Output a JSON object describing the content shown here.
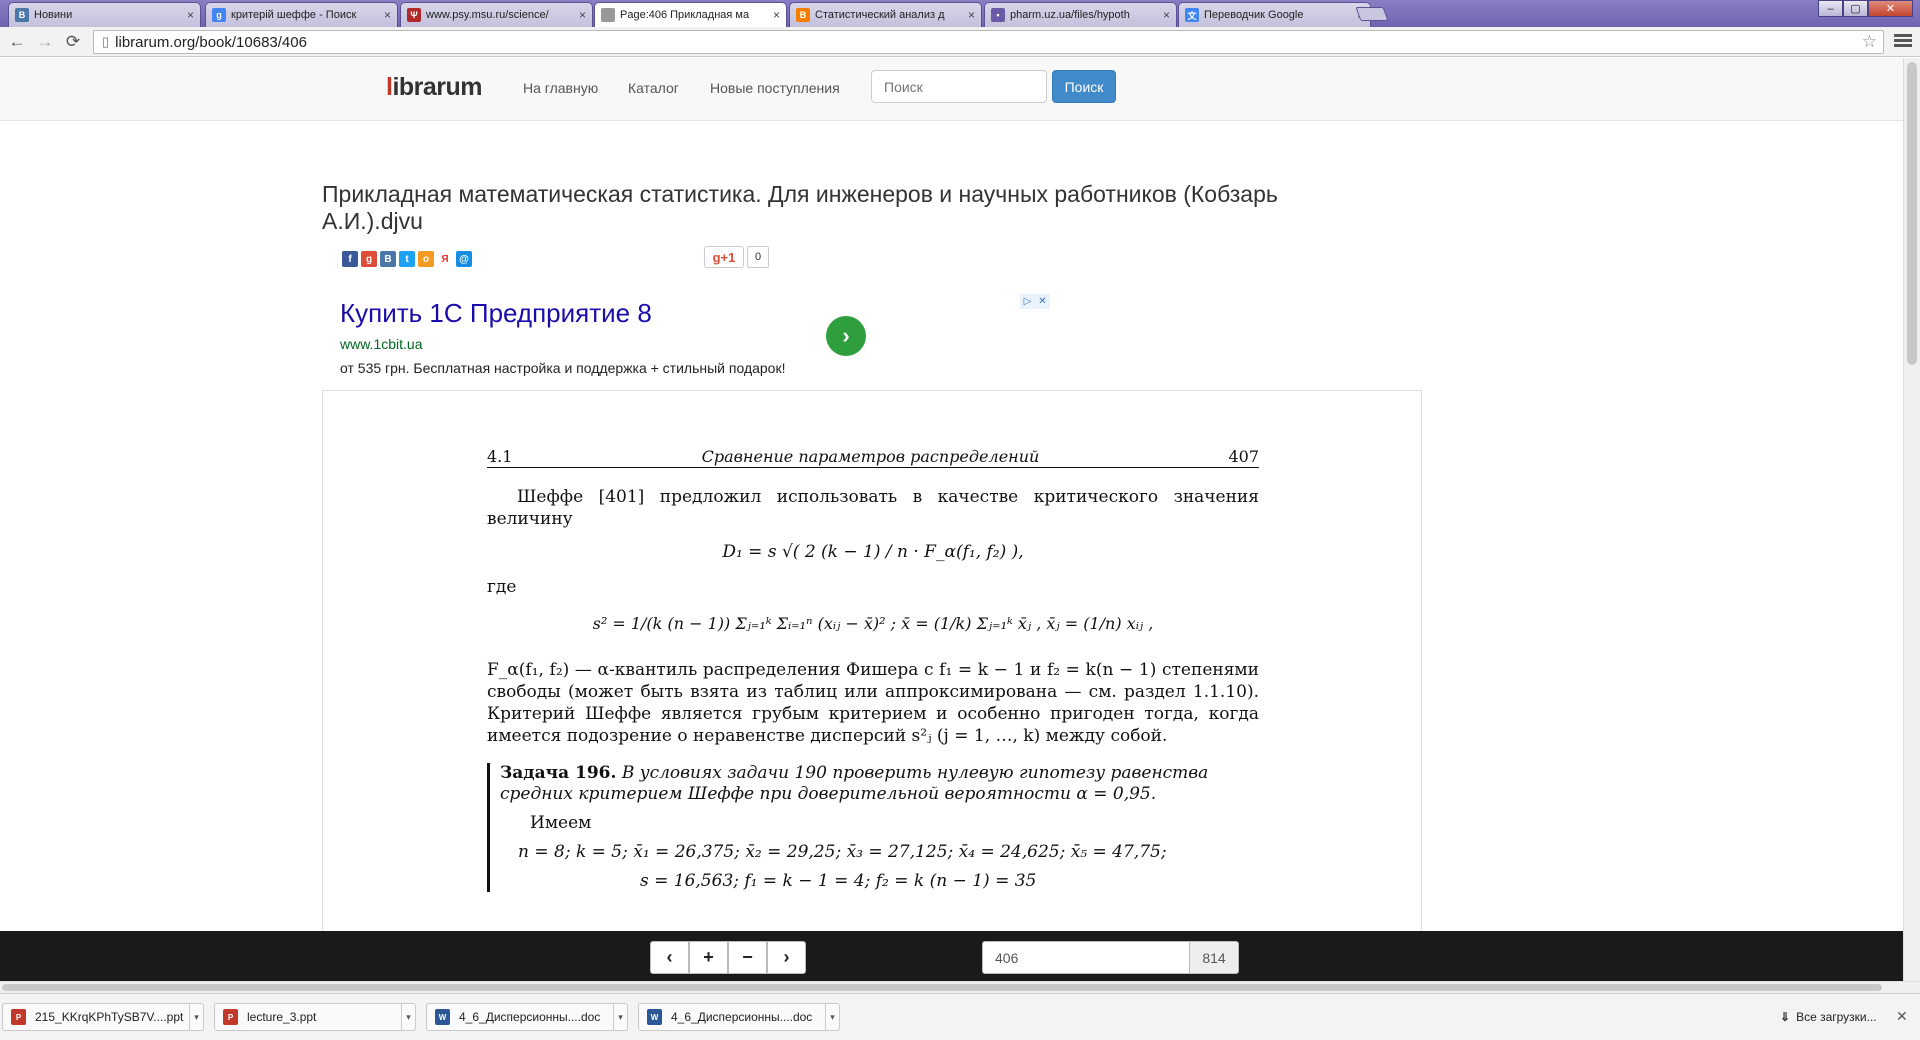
{
  "tabs": [
    {
      "label": "Новини",
      "favicon": "vk-icon",
      "color": "#4a76a8",
      "glyph": "В"
    },
    {
      "label": "критерій шеффе - Поиск",
      "favicon": "google-icon",
      "color": "#4285f4",
      "glyph": "g"
    },
    {
      "label": "www.psy.msu.ru/science/",
      "favicon": "psi-icon",
      "color": "#b02a2a",
      "glyph": "Ψ"
    },
    {
      "label": "Page:406 Прикладная ма",
      "favicon": "page-icon",
      "color": "#999999",
      "glyph": "",
      "active": true
    },
    {
      "label": "Статистический анализ д",
      "favicon": "blogger-icon",
      "color": "#f57d00",
      "glyph": "B"
    },
    {
      "label": "pharm.uz.ua/files/hypoth",
      "favicon": "site-icon",
      "color": "#6b5aa8",
      "glyph": "▪"
    },
    {
      "label": "Переводчик Google",
      "favicon": "translate-icon",
      "color": "#4285f4",
      "glyph": "文"
    }
  ],
  "address": {
    "url": "librarum.org/book/10683/406"
  },
  "site": {
    "logo_l": "l",
    "logo_rest": "ibrarum",
    "nav": [
      "На главную",
      "Каталог",
      "Новые поступления"
    ],
    "search_placeholder": "Поиск",
    "search_button": "Поиск"
  },
  "book": {
    "title": "Прикладная математическая статистика. Для инженеров и научных работников (Кобзарь А.И.).djvu"
  },
  "social": {
    "gplus_label": "g+1",
    "gplus_count": "0",
    "icons": [
      {
        "name": "facebook-icon",
        "color": "#3b5998",
        "glyph": "f"
      },
      {
        "name": "google-plus-icon",
        "color": "#dd4b39",
        "glyph": "g"
      },
      {
        "name": "vkontakte-icon",
        "color": "#4a76a8",
        "glyph": "B"
      },
      {
        "name": "twitter-icon",
        "color": "#1da1f2",
        "glyph": "t"
      },
      {
        "name": "odnoklassniki-icon",
        "color": "#f59a23",
        "glyph": "o"
      },
      {
        "name": "yandex-icon",
        "color": "#ffffff",
        "glyph": "Я"
      },
      {
        "name": "mailru-icon",
        "color": "#168de2",
        "glyph": "@"
      }
    ]
  },
  "ad": {
    "title": "Купить 1С Предприятие 8",
    "url": "www.1cbit.ua",
    "description": "от 535 грн. Бесплатная настройка и поддержка + стильный подарок!"
  },
  "scan": {
    "section": "4.1",
    "running_title": "Сравнение параметров распределений",
    "page_number": "407",
    "para1": "Шеффе [401] предложил использовать в качестве критического значения величину",
    "formula1": "D₁ = s √( 2 (k − 1) / n · F_α(f₁, f₂) ),",
    "where": "где",
    "formula2": "s² = 1/(k (n − 1)) Σⱼ₌₁ᵏ Σᵢ₌₁ⁿ (xᵢⱼ − x̄)² ;    x̄ = (1/k) Σⱼ₌₁ᵏ x̄ⱼ ,    x̄ⱼ = (1/n) xᵢⱼ ,",
    "para2": "F_α(f₁, f₂) — α-квантиль распределения Фишера с f₁ = k − 1 и f₂ = k(n − 1) степенями свободы (может быть взята из таблиц или аппроксимирована — см. раздел 1.1.10). Критерий Шеффе является грубым критерием и особенно пригоден тогда, когда имеется подозрение о неравенстве дисперсий s²ⱼ (j = 1, …, k) между собой.",
    "problem_label": "Задача 196.",
    "problem_text": "В условиях задачи 190 проверить нулевую гипотезу равенства средних критерием Шеффе при доверительной вероятности α = 0,95.",
    "have": "Имеем",
    "values_line": "n = 8;    k = 5;    x̄₁ = 26,375;    x̄₂ = 29,25;    x̄₃ = 27,125;    x̄₄ = 24,625;    x̄₅ = 47,75;",
    "values_line2": "s = 16,563;    f₁ = k − 1 = 4;    f₂ = k (n − 1) = 35"
  },
  "viewer": {
    "current_page": "406",
    "total_pages": "814"
  },
  "downloads": {
    "items": [
      {
        "label": "215_KKrqKPhTySB7V....ppt",
        "type": "ppt",
        "color": "#c0392b"
      },
      {
        "label": "lecture_3.ppt",
        "type": "ppt",
        "color": "#c0392b"
      },
      {
        "label": "4_6_Дисперсионны....doc",
        "type": "doc",
        "color": "#2b5797"
      },
      {
        "label": "4_6_Дисперсионны....doc",
        "type": "doc",
        "color": "#2b5797"
      }
    ],
    "all_label": "Все загрузки..."
  }
}
